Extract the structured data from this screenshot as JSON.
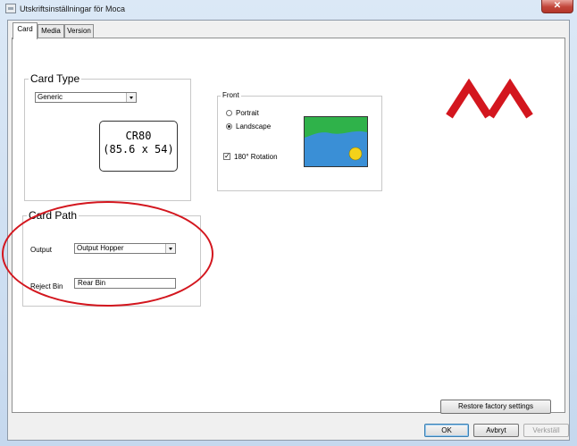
{
  "window": {
    "title": "Utskriftsinställningar för Moca",
    "close_glyph": "✕"
  },
  "tabs": [
    {
      "label": "Card",
      "active": true
    },
    {
      "label": "Media",
      "active": false
    },
    {
      "label": "Version",
      "active": false
    }
  ],
  "card_type": {
    "legend": "Card Type",
    "selected": "Generic",
    "card_name": "CR80",
    "card_dims": "(85.6 x 54)"
  },
  "front": {
    "legend": "Front",
    "portrait_label": "Portrait",
    "landscape_label": "Landscape",
    "selected_orientation": "Landscape",
    "rotation_label": "180° Rotation",
    "rotation_checked": true
  },
  "card_path": {
    "legend": "Card Path",
    "output_label": "Output",
    "output_value": "Output Hopper",
    "reject_label": "Reject Bin",
    "reject_value": "Rear Bin"
  },
  "buttons": {
    "restore": "Restore factory settings",
    "ok": "OK",
    "cancel": "Avbryt",
    "apply": "Verkställ"
  },
  "colors": {
    "logo": "#d3161e",
    "highlight": "#d3161e",
    "preview_sky": "#3a8fd6",
    "preview_grass": "#2fb24a",
    "preview_sun": "#f3d21a"
  }
}
